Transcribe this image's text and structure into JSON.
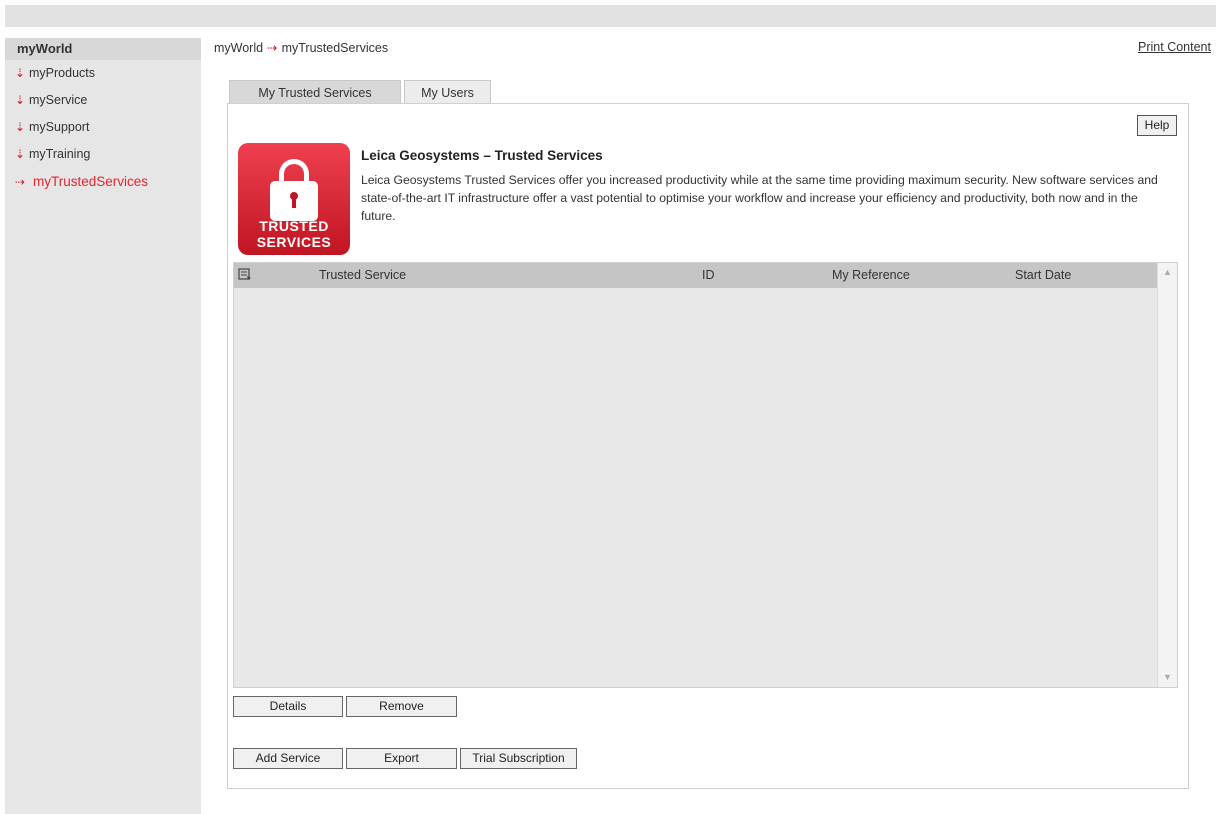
{
  "sidebar": {
    "header": "myWorld",
    "items": [
      {
        "label": "myProducts",
        "arrow": "⇣"
      },
      {
        "label": "myService",
        "arrow": "⇣"
      },
      {
        "label": "mySupport",
        "arrow": "⇣"
      },
      {
        "label": "myTraining",
        "arrow": "⇣"
      },
      {
        "label": "myTrustedServices",
        "arrow": "⇢"
      }
    ]
  },
  "breadcrumb": {
    "root": "myWorld",
    "separator": "⇢",
    "current": "myTrustedServices"
  },
  "print_link": "Print Content",
  "tabs": [
    {
      "label": "My Trusted Services",
      "active": true
    },
    {
      "label": "My Users",
      "active": false
    }
  ],
  "help_button": "Help",
  "logo": {
    "line1": "TRUSTED",
    "line2": "SERVICES",
    "icon": "lock-icon"
  },
  "intro": {
    "title": "Leica Geosystems – Trusted Services",
    "text": "Leica Geosystems Trusted Services offer you increased productivity while at the same time providing maximum security. New software services and state-of-the-art IT infrastructure offer a vast potential to optimise your workflow and increase your efficiency and productivity, both now and in the future."
  },
  "table": {
    "columns": [
      "Trusted Service",
      "ID",
      "My Reference",
      "Start Date"
    ],
    "rows": []
  },
  "buttons": {
    "details": "Details",
    "remove": "Remove",
    "add_service": "Add Service",
    "export": "Export",
    "trial": "Trial Subscription"
  },
  "colors": {
    "accent": "#e1262e",
    "logo_red": "#c01522"
  }
}
